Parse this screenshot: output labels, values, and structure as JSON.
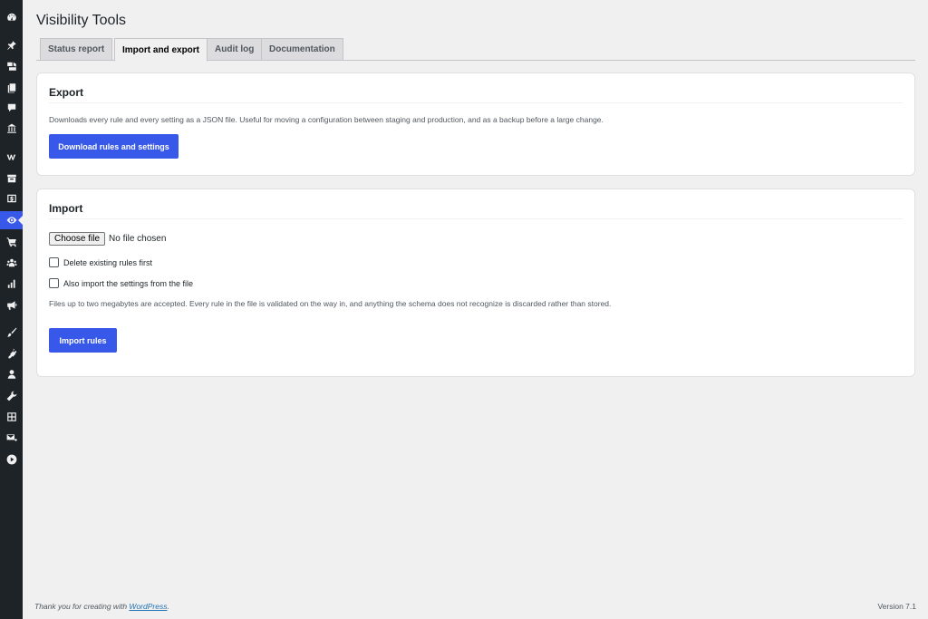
{
  "sidebar": {
    "icons": [
      "dashboard-icon",
      "pin-icon",
      "media-icon",
      "pages-icon",
      "comments-icon",
      "bank-icon",
      "woo-icon",
      "archive-icon",
      "dollar-icon",
      "eye-icon",
      "cart-icon",
      "users-group-icon",
      "chart-icon",
      "megaphone-icon",
      "brush-icon",
      "plugins-icon",
      "user-icon",
      "wrench-icon",
      "settings-grid-icon",
      "mail-icon",
      "play-icon"
    ],
    "active": "eye-icon"
  },
  "page": {
    "title": "Visibility Tools"
  },
  "tabs": [
    {
      "label": "Status report",
      "active": false
    },
    {
      "label": "Import and export",
      "active": true
    },
    {
      "label": "Audit log",
      "active": false
    },
    {
      "label": "Documentation",
      "active": false
    }
  ],
  "export": {
    "title": "Export",
    "description": "Downloads every rule and every setting as a JSON file. Useful for moving a configuration between staging and production, and as a backup before a large change.",
    "button_label": "Download rules and settings"
  },
  "import": {
    "title": "Import",
    "file_button_label": "Choose file",
    "file_status": "No file chosen",
    "checkbox_delete_label": "Delete existing rules first",
    "checkbox_delete_checked": false,
    "checkbox_settings_label": "Also import the settings from the file",
    "checkbox_settings_checked": false,
    "description": "Files up to two megabytes are accepted. Every rule in the file is validated on the way in, and anything the schema does not recognize is discarded rather than stored.",
    "button_label": "Import rules"
  },
  "footer": {
    "thanks_prefix": "Thank you for creating with ",
    "thanks_link": "WordPress",
    "thanks_suffix": ".",
    "version": "Version 7.1"
  },
  "colors": {
    "accent": "#3858e9",
    "sidebar_bg": "#1d2327",
    "page_bg": "#f0f0f1"
  }
}
